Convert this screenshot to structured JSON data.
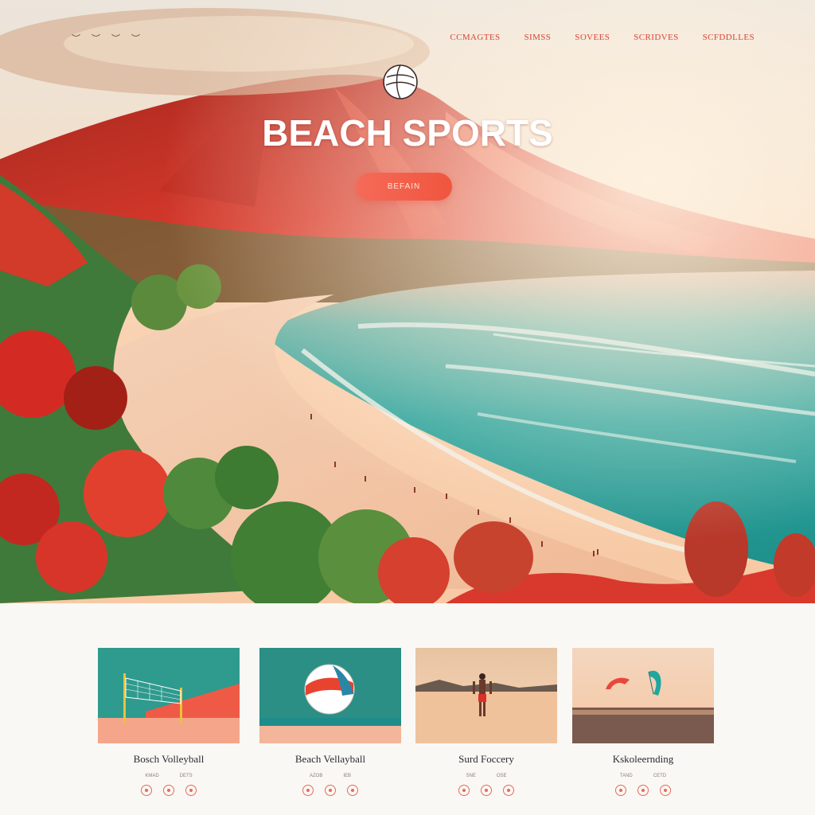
{
  "nav": {
    "birds": [
      "︶",
      "︶",
      "︶",
      "︶"
    ],
    "links": [
      "CCMAGTES",
      "SIMSS",
      "SOVEES",
      "SCRIDVES",
      "SCFDDLLES"
    ]
  },
  "hero": {
    "title": "BEACH SPORTS",
    "cta_label": "BEFAIN"
  },
  "cards": [
    {
      "title": "Bosch Volleyball",
      "meta": [
        "KMAD",
        "DETS"
      ]
    },
    {
      "title": "Beach Vellayball",
      "meta": [
        "AZOB",
        "IEB"
      ]
    },
    {
      "title": "Surd Foccery",
      "meta": [
        "SNE",
        "OSE"
      ]
    },
    {
      "title": "Kskoleernding",
      "meta": [
        "TAND",
        "CETD"
      ]
    }
  ],
  "colors": {
    "accent": "#f0553f",
    "nav_link": "#d9453a",
    "sea": "#27a7a0",
    "sand": "#f2c5a5"
  }
}
